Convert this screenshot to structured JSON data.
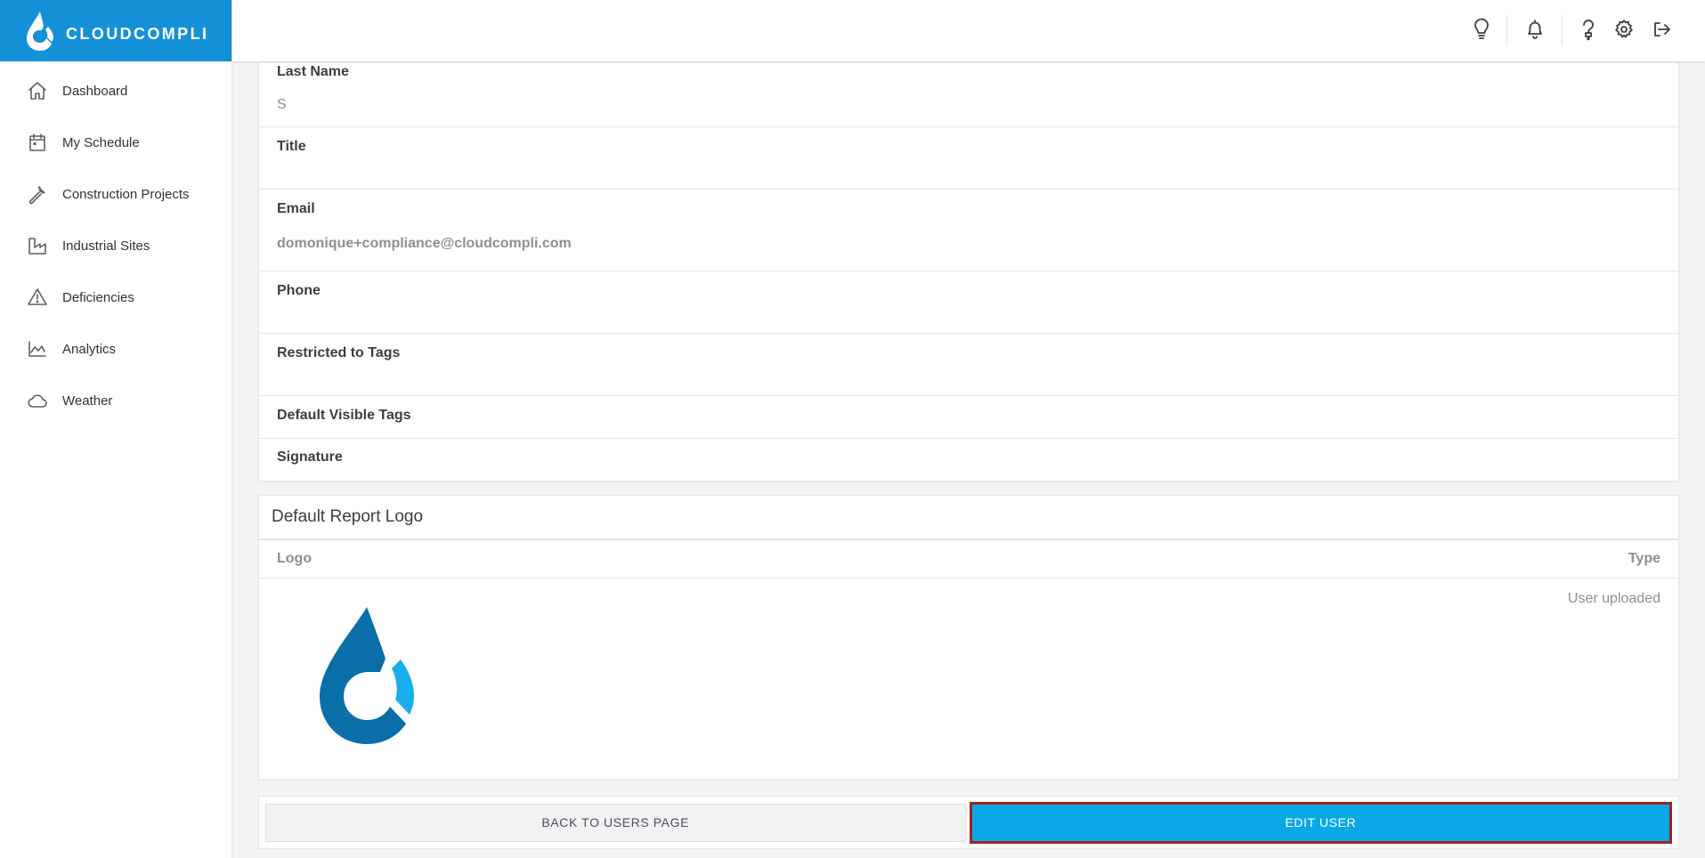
{
  "brand": {
    "name": "CLOUDCOMPLI",
    "primary_color": "#1591d7"
  },
  "sidebar": {
    "items": [
      {
        "label": "Dashboard",
        "icon": "home-icon"
      },
      {
        "label": "My Schedule",
        "icon": "calendar-icon"
      },
      {
        "label": "Construction Projects",
        "icon": "wrench-icon"
      },
      {
        "label": "Industrial Sites",
        "icon": "factory-icon"
      },
      {
        "label": "Deficiencies",
        "icon": "warning-icon"
      },
      {
        "label": "Analytics",
        "icon": "chart-icon"
      },
      {
        "label": "Weather",
        "icon": "cloud-icon"
      }
    ]
  },
  "topbar": {
    "icons": [
      "lightbulb-icon",
      "bell-icon",
      "help-icon",
      "gear-icon",
      "logout-icon"
    ]
  },
  "user_details": {
    "last_name": {
      "label": "Last Name",
      "value": "S"
    },
    "title": {
      "label": "Title",
      "value": ""
    },
    "email": {
      "label": "Email",
      "value": "domonique+compliance@cloudcompli.com"
    },
    "phone": {
      "label": "Phone",
      "value": ""
    },
    "restricted_tags": {
      "label": "Restricted to Tags",
      "value": ""
    },
    "default_visible_tags": {
      "label": "Default Visible Tags"
    },
    "signature": {
      "label": "Signature"
    }
  },
  "report_logo": {
    "title": "Default Report Logo",
    "columns": {
      "logo": "Logo",
      "type": "Type"
    },
    "row": {
      "type": "User uploaded"
    }
  },
  "actions": {
    "back_label": "BACK TO USERS PAGE",
    "edit_label": "EDIT USER",
    "edit_color": "#09a9e8"
  }
}
